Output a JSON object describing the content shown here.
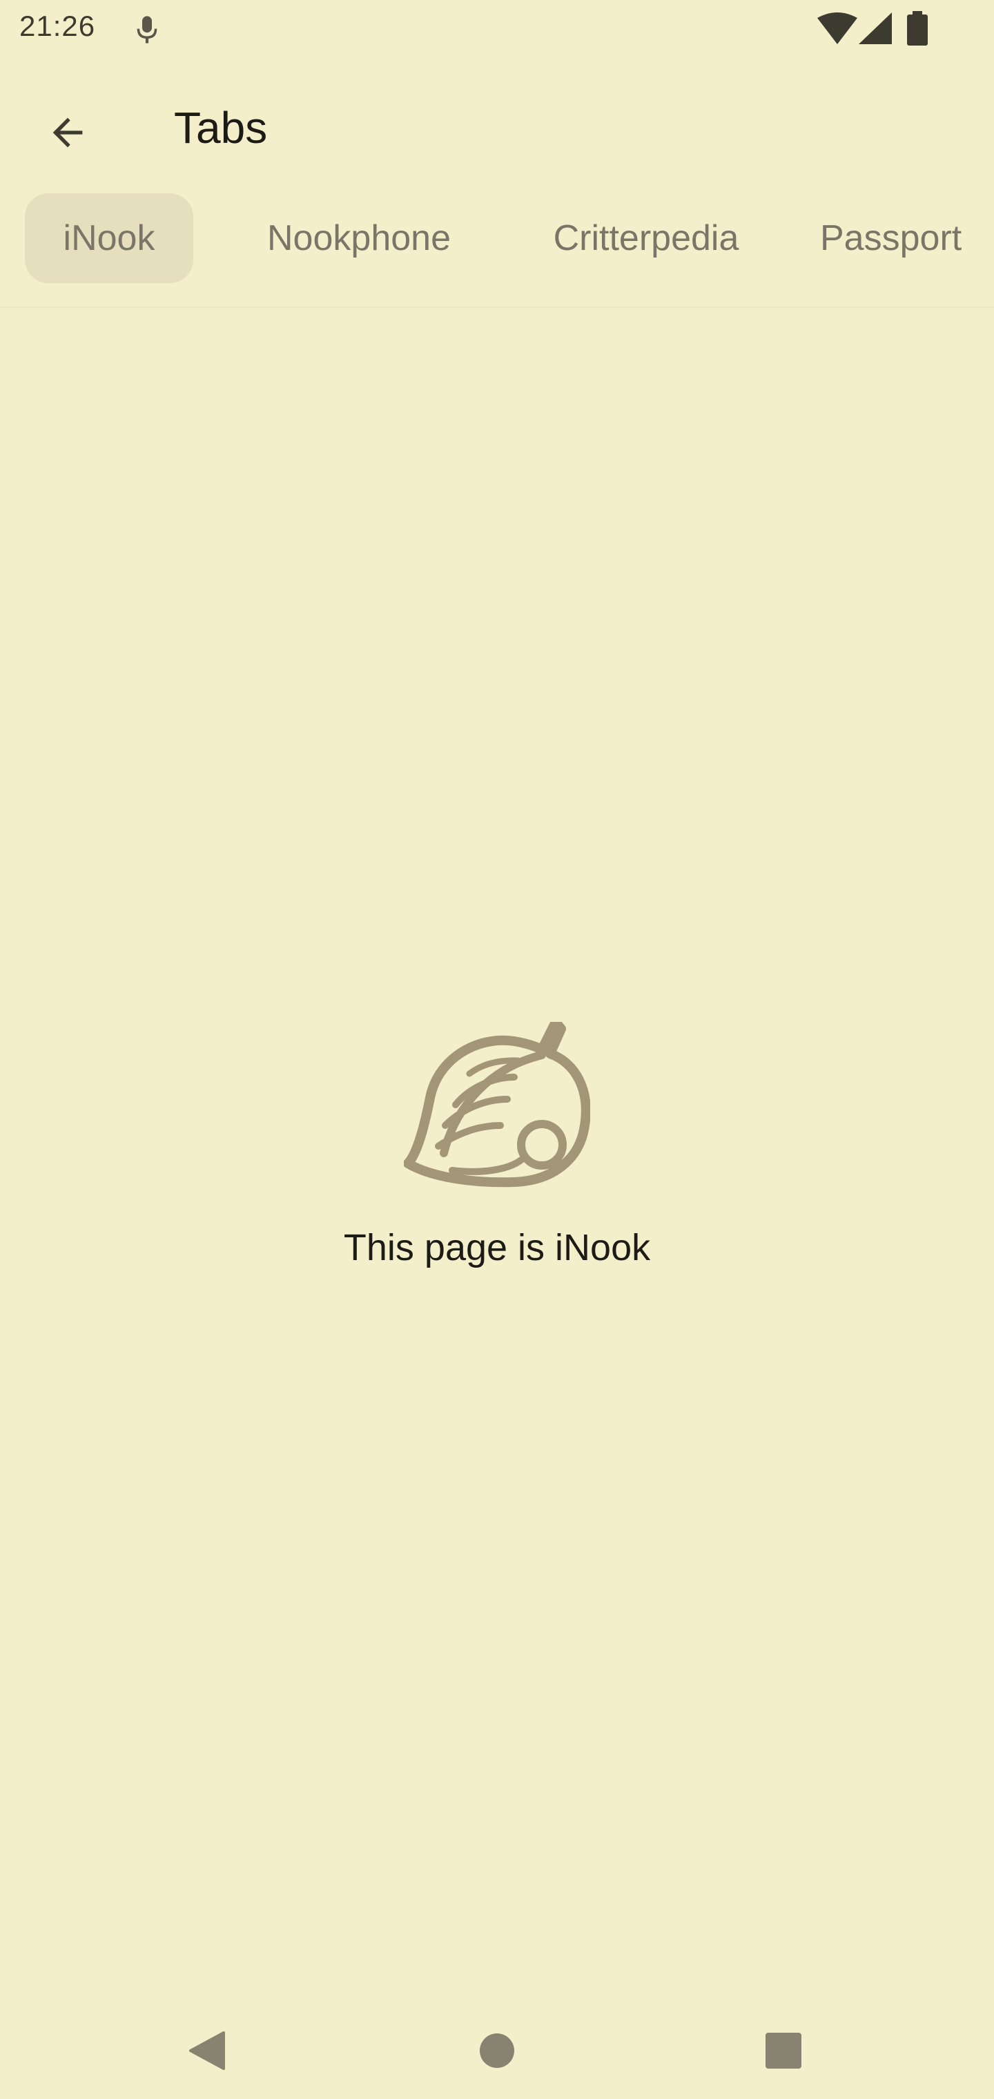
{
  "status_bar": {
    "time": "21:26",
    "icons": [
      "mic-icon",
      "wifi-icon",
      "signal-icon",
      "battery-icon"
    ]
  },
  "app_bar": {
    "title": "Tabs",
    "back_icon": "arrow-back-icon"
  },
  "tabs": [
    {
      "label": "iNook",
      "selected": true
    },
    {
      "label": "Nookphone",
      "selected": false
    },
    {
      "label": "Critterpedia",
      "selected": false
    },
    {
      "label": "Passport",
      "selected": false
    }
  ],
  "content": {
    "icon": "leaf-icon",
    "message": "This page is iNook"
  },
  "nav_bar": {
    "icons": [
      "nav-back-icon",
      "nav-home-icon",
      "nav-recents-icon"
    ]
  },
  "colors": {
    "background": "#f4efcb",
    "selected_tab": "#e5dfbd",
    "tab_text": "#7a7566",
    "leaf": "#a39676",
    "nav_icons": "#888270"
  }
}
